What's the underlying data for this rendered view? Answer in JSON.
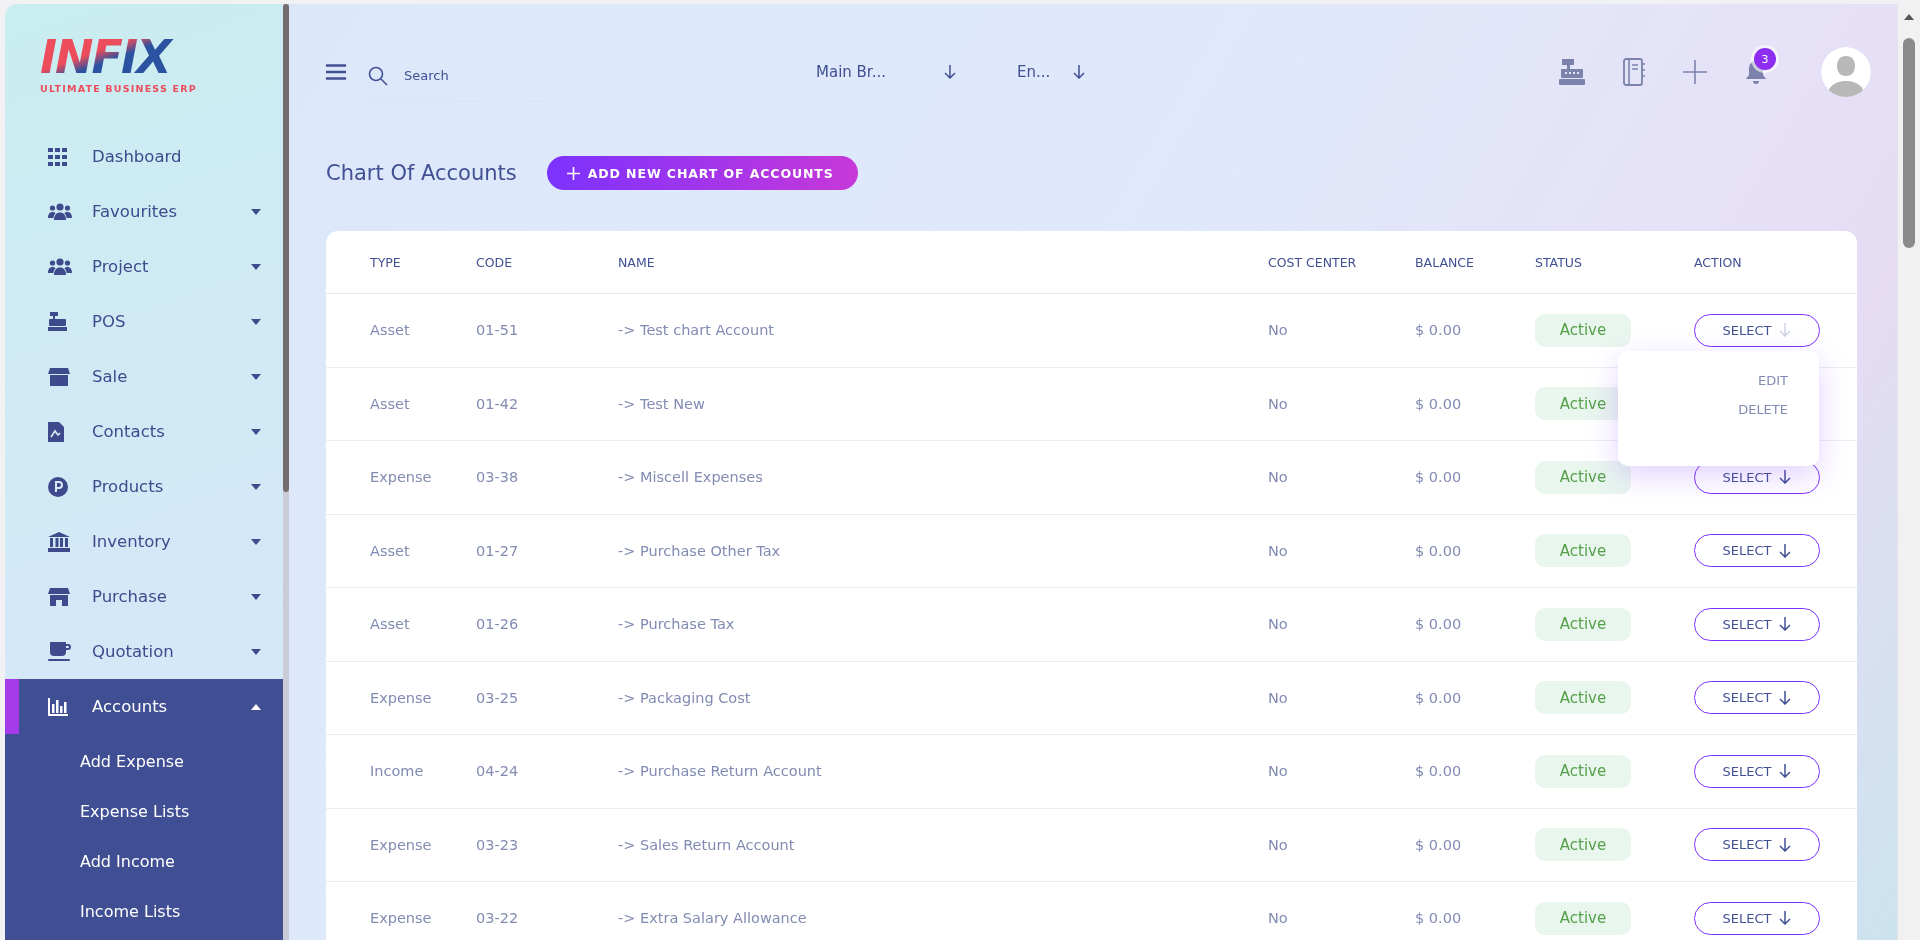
{
  "logo": {
    "name": "INFIX",
    "tagline": "ULTIMATE BUSINESS ERP"
  },
  "sidebar": {
    "items": [
      {
        "label": "Dashboard",
        "selected": false
      },
      {
        "label": "Favourites",
        "expanded": false,
        "selected": false
      },
      {
        "label": "Project",
        "expanded": false,
        "selected": false
      },
      {
        "label": "POS",
        "expanded": false,
        "selected": false
      },
      {
        "label": "Sale",
        "expanded": false,
        "selected": false
      },
      {
        "label": "Contacts",
        "expanded": false,
        "selected": false
      },
      {
        "label": "Products",
        "expanded": false,
        "selected": false
      },
      {
        "label": "Inventory",
        "expanded": false,
        "selected": false
      },
      {
        "label": "Purchase",
        "expanded": false,
        "selected": false
      },
      {
        "label": "Quotation",
        "expanded": false,
        "selected": false
      },
      {
        "label": "Accounts",
        "expanded": true,
        "selected": true,
        "children": [
          {
            "label": "Add Expense"
          },
          {
            "label": "Expense Lists"
          },
          {
            "label": "Add Income"
          },
          {
            "label": "Income Lists"
          }
        ]
      }
    ]
  },
  "header": {
    "search": {
      "placeholder": "Search"
    },
    "branch": "Main Br...",
    "language": "En...",
    "notifications": "3"
  },
  "page": {
    "title": "Chart Of Accounts",
    "add_button": "ADD NEW CHART OF ACCOUNTS"
  },
  "table": {
    "columns": [
      "TYPE",
      "CODE",
      "NAME",
      "COST CENTER",
      "BALANCE",
      "STATUS",
      "ACTION"
    ],
    "rows": [
      {
        "type": "Asset",
        "code": "01-51",
        "name": "-> Test chart Account",
        "cost_center": "No",
        "balance": "$ 0.00",
        "status": "Active",
        "action": "SELECT",
        "expanded": true
      },
      {
        "type": "Asset",
        "code": "01-42",
        "name": "-> Test New",
        "cost_center": "No",
        "balance": "$ 0.00",
        "status": "Active"
      },
      {
        "type": "Expense",
        "code": "03-38",
        "name": "-> Miscell Expenses",
        "cost_center": "No",
        "balance": "$ 0.00",
        "status": "Active",
        "action": "SELECT",
        "expanded": false
      },
      {
        "type": "Asset",
        "code": "01-27",
        "name": "-> Purchase Other Tax",
        "cost_center": "No",
        "balance": "$ 0.00",
        "status": "Active",
        "action": "SELECT",
        "expanded": false
      },
      {
        "type": "Asset",
        "code": "01-26",
        "name": "-> Purchase Tax",
        "cost_center": "No",
        "balance": "$ 0.00",
        "status": "Active",
        "action": "SELECT",
        "expanded": false
      },
      {
        "type": "Expense",
        "code": "03-25",
        "name": "-> Packaging Cost",
        "cost_center": "No",
        "balance": "$ 0.00",
        "status": "Active",
        "action": "SELECT",
        "expanded": false
      },
      {
        "type": "Income",
        "code": "04-24",
        "name": "-> Purchase Return Account",
        "cost_center": "No",
        "balance": "$ 0.00",
        "status": "Active",
        "action": "SELECT",
        "expanded": false
      },
      {
        "type": "Expense",
        "code": "03-23",
        "name": "-> Sales Return Account",
        "cost_center": "No",
        "balance": "$ 0.00",
        "status": "Active",
        "action": "SELECT",
        "expanded": false
      },
      {
        "type": "Expense",
        "code": "03-22",
        "name": "-> Extra Salary Allowance",
        "cost_center": "No",
        "balance": "$ 0.00",
        "status": "Active",
        "action": "SELECT",
        "expanded": false
      }
    ],
    "action_menu": [
      "EDIT",
      "DELETE"
    ]
  }
}
